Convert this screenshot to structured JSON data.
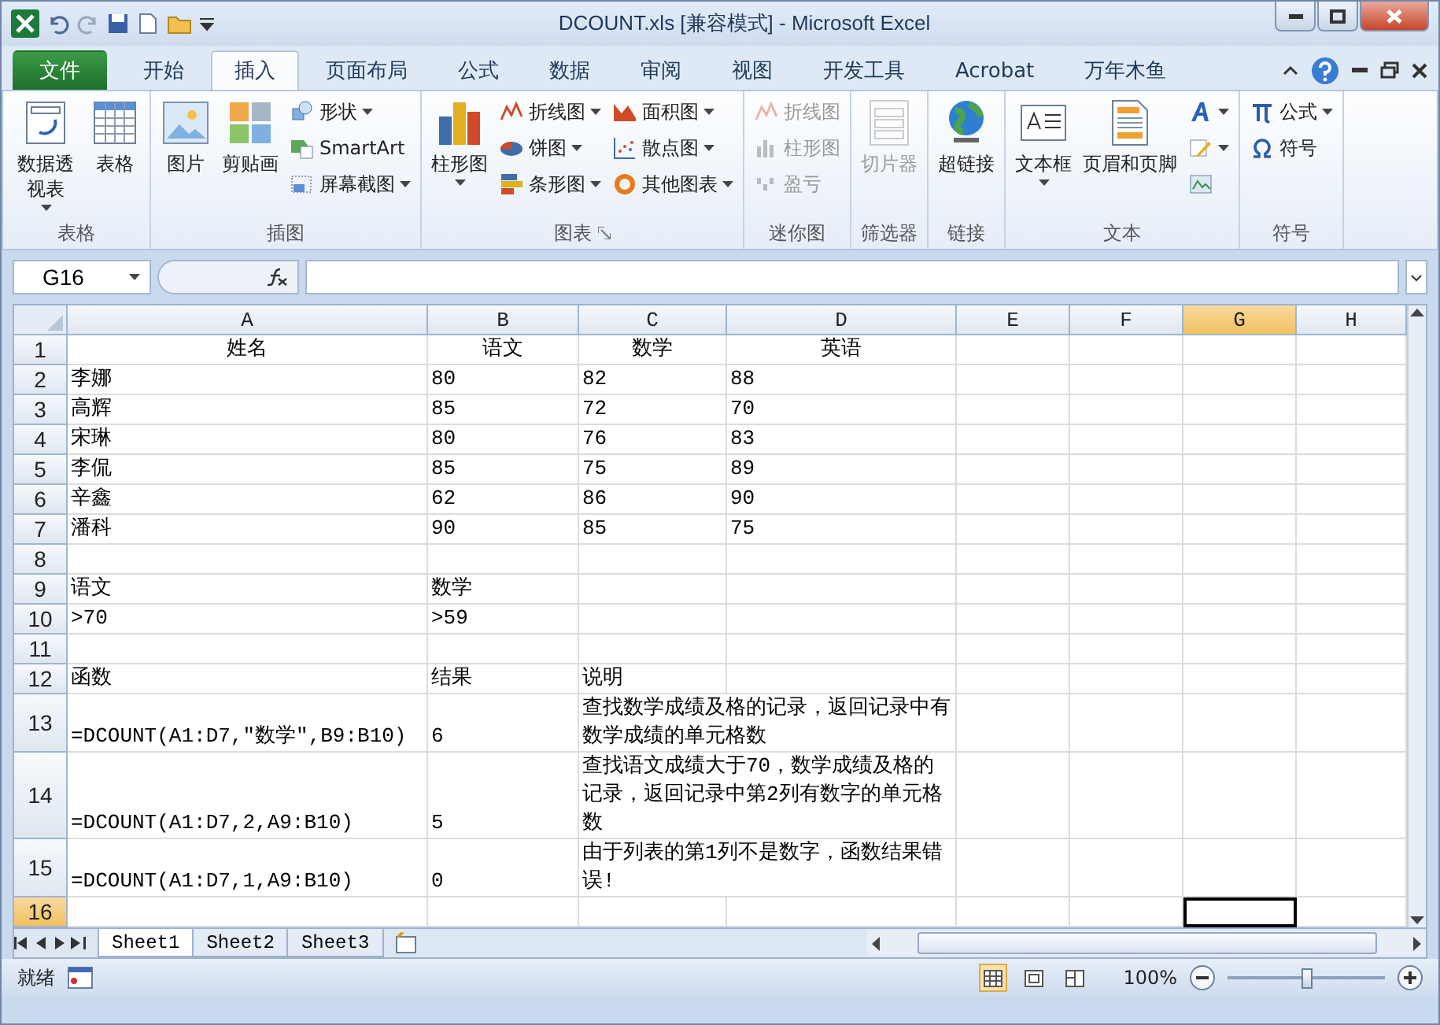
{
  "window": {
    "title": "DCOUNT.xls  [兼容模式]  -  Microsoft Excel"
  },
  "tabs": [
    {
      "label": "文件",
      "kind": "file",
      "selected": false
    },
    {
      "label": "开始",
      "kind": "tab",
      "selected": false
    },
    {
      "label": "插入",
      "kind": "tab",
      "selected": true
    },
    {
      "label": "页面布局",
      "kind": "tab",
      "selected": false
    },
    {
      "label": "公式",
      "kind": "tab",
      "selected": false
    },
    {
      "label": "数据",
      "kind": "tab",
      "selected": false
    },
    {
      "label": "审阅",
      "kind": "tab",
      "selected": false
    },
    {
      "label": "视图",
      "kind": "tab",
      "selected": false
    },
    {
      "label": "开发工具",
      "kind": "tab",
      "selected": false
    },
    {
      "label": "Acrobat",
      "kind": "tab",
      "selected": false
    },
    {
      "label": "万年木鱼",
      "kind": "tab",
      "selected": false
    }
  ],
  "ribbon": {
    "groups": [
      {
        "label": "表格",
        "launcher": false,
        "items": [
          {
            "label": "数据透视表",
            "kind": "large",
            "dropdown": true,
            "disabled": false
          },
          {
            "label": "表格",
            "kind": "large",
            "dropdown": false,
            "disabled": false
          }
        ]
      },
      {
        "label": "插图",
        "launcher": false,
        "items": [
          {
            "label": "图片",
            "kind": "large",
            "dropdown": false,
            "disabled": false
          },
          {
            "label": "剪贴画",
            "kind": "large",
            "dropdown": false,
            "disabled": false
          },
          {
            "label": "形状",
            "kind": "small",
            "dropdown": true,
            "disabled": false
          },
          {
            "label": "SmartArt",
            "kind": "small",
            "dropdown": false,
            "disabled": false
          },
          {
            "label": "屏幕截图",
            "kind": "small",
            "dropdown": true,
            "disabled": false
          }
        ]
      },
      {
        "label": "图表",
        "launcher": true,
        "items": [
          {
            "label": "柱形图",
            "kind": "large",
            "dropdown": true,
            "disabled": false
          },
          {
            "label": "折线图",
            "kind": "small",
            "dropdown": true,
            "disabled": false
          },
          {
            "label": "饼图",
            "kind": "small",
            "dropdown": true,
            "disabled": false
          },
          {
            "label": "条形图",
            "kind": "small",
            "dropdown": true,
            "disabled": false
          },
          {
            "label": "面积图",
            "kind": "small",
            "dropdown": true,
            "disabled": false
          },
          {
            "label": "散点图",
            "kind": "small",
            "dropdown": true,
            "disabled": false
          },
          {
            "label": "其他图表",
            "kind": "small",
            "dropdown": true,
            "disabled": false
          }
        ]
      },
      {
        "label": "迷你图",
        "launcher": false,
        "items": [
          {
            "label": "折线图",
            "kind": "small",
            "dropdown": false,
            "disabled": true
          },
          {
            "label": "柱形图",
            "kind": "small",
            "dropdown": false,
            "disabled": true
          },
          {
            "label": "盈亏",
            "kind": "small",
            "dropdown": false,
            "disabled": true
          }
        ]
      },
      {
        "label": "筛选器",
        "launcher": false,
        "items": [
          {
            "label": "切片器",
            "kind": "large",
            "dropdown": false,
            "disabled": true
          }
        ]
      },
      {
        "label": "链接",
        "launcher": false,
        "items": [
          {
            "label": "超链接",
            "kind": "large",
            "dropdown": false,
            "disabled": false
          }
        ]
      },
      {
        "label": "文本",
        "launcher": false,
        "items": [
          {
            "label": "文本框",
            "kind": "large",
            "dropdown": true,
            "disabled": false
          },
          {
            "label": "页眉和页脚",
            "kind": "large",
            "dropdown": false,
            "disabled": false
          },
          {
            "kind": "icon",
            "dropdown": true,
            "disabled": false
          },
          {
            "kind": "icon",
            "dropdown": true,
            "disabled": false
          },
          {
            "kind": "icon",
            "dropdown": false,
            "disabled": false
          }
        ]
      },
      {
        "label": "符号",
        "launcher": false,
        "items": [
          {
            "label": "公式",
            "kind": "small",
            "dropdown": true,
            "disabled": false
          },
          {
            "label": "符号",
            "kind": "small",
            "dropdown": false,
            "disabled": false
          }
        ]
      }
    ]
  },
  "formula_bar": {
    "name_box": "G16"
  },
  "sheet": {
    "columns": [
      {
        "label": "A",
        "selected": false
      },
      {
        "label": "B",
        "selected": false
      },
      {
        "label": "C",
        "selected": false
      },
      {
        "label": "D",
        "selected": false
      },
      {
        "label": "E",
        "selected": false
      },
      {
        "label": "F",
        "selected": false
      },
      {
        "label": "G",
        "selected": true
      },
      {
        "label": "H",
        "selected": false
      }
    ],
    "rows": [
      {
        "number": "1",
        "kind": "header",
        "selected": false,
        "cells": [
          "姓名",
          "语文",
          "数学",
          "英语"
        ]
      },
      {
        "number": "2",
        "kind": "data",
        "selected": false,
        "cells": [
          "李娜",
          "80",
          "82",
          "88"
        ]
      },
      {
        "number": "3",
        "kind": "data",
        "selected": false,
        "cells": [
          "高辉",
          "85",
          "72",
          "70"
        ]
      },
      {
        "number": "4",
        "kind": "data",
        "selected": false,
        "cells": [
          "宋琳",
          "80",
          "76",
          "83"
        ]
      },
      {
        "number": "5",
        "kind": "data",
        "selected": false,
        "cells": [
          "李侃",
          "85",
          "75",
          "89"
        ]
      },
      {
        "number": "6",
        "kind": "data",
        "selected": false,
        "cells": [
          "辛鑫",
          "62",
          "86",
          "90"
        ]
      },
      {
        "number": "7",
        "kind": "data",
        "selected": false,
        "cells": [
          "潘科",
          "90",
          "85",
          "75"
        ]
      },
      {
        "number": "8",
        "kind": "empty",
        "selected": false
      },
      {
        "number": "9",
        "kind": "data",
        "selected": false,
        "cells": [
          "语文",
          "数学"
        ]
      },
      {
        "number": "10",
        "kind": "data",
        "selected": false,
        "cells": [
          ">70",
          ">59"
        ]
      },
      {
        "number": "11",
        "kind": "empty",
        "selected": false
      },
      {
        "number": "12",
        "kind": "data",
        "selected": false,
        "cells": [
          "函数",
          "结果",
          "说明"
        ]
      },
      {
        "number": "13",
        "kind": "note",
        "selected": false,
        "cells": [
          "=DCOUNT(A1:D7,\"数学\",B9:B10)",
          "6",
          "查找数学成绩及格的记录，返回记录中有数学成绩的单元格数"
        ]
      },
      {
        "number": "14",
        "kind": "note",
        "selected": false,
        "cells": [
          "=DCOUNT(A1:D7,2,A9:B10)",
          "5",
          "查找语文成绩大于70，数学成绩及格的记录，返回记录中第2列有数字的单元格数"
        ]
      },
      {
        "number": "15",
        "kind": "note",
        "selected": false,
        "cells": [
          "=DCOUNT(A1:D7,1,A9:B10)",
          "0",
          "由于列表的第1列不是数字，函数结果错误!"
        ]
      },
      {
        "number": "16",
        "kind": "empty",
        "selected": true
      }
    ]
  },
  "sheet_tabs": [
    {
      "label": "Sheet1",
      "selected": true
    },
    {
      "label": "Sheet2",
      "selected": false
    },
    {
      "label": "Sheet3",
      "selected": false
    }
  ],
  "status_bar": {
    "status": "就绪",
    "views": [
      {
        "selected": true
      },
      {
        "selected": false
      },
      {
        "selected": false
      }
    ],
    "zoom": "100%",
    "zoom_level": {
      "level": 0.5
    }
  }
}
